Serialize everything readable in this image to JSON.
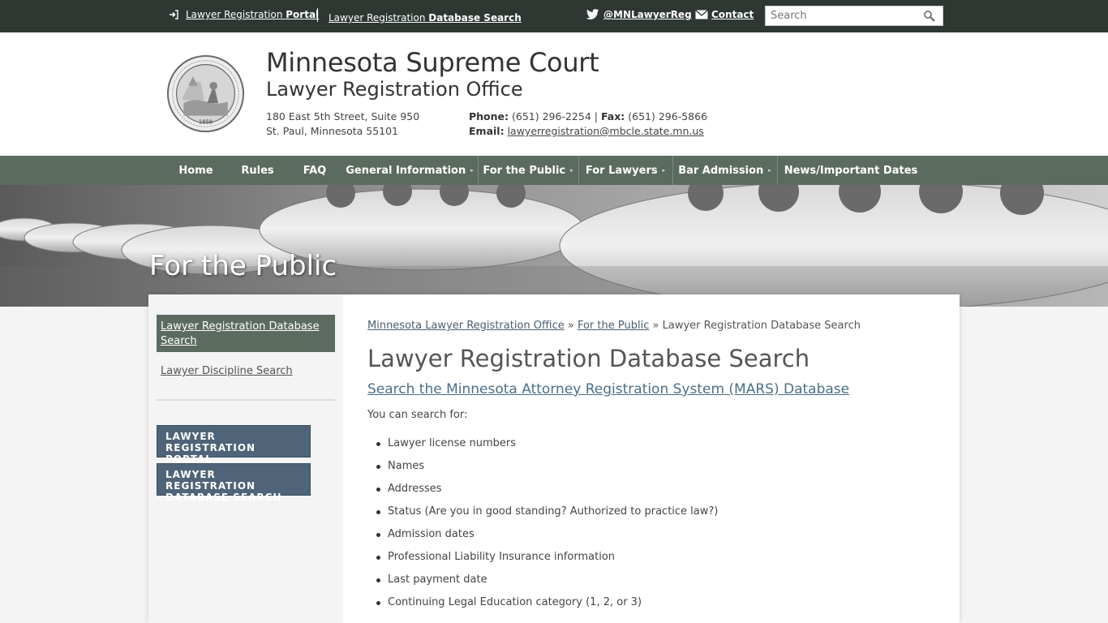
{
  "topbar": {
    "portal_prefix": "Lawyer Registration ",
    "portal_bold": "Portal",
    "db_prefix": "Lawyer Registration ",
    "db_bold": "Database Search",
    "twitter": "@MNLawyerReg",
    "contact": "Contact",
    "search_placeholder": "Search"
  },
  "header": {
    "title": "Minnesota Supreme Court",
    "subtitle": "Lawyer Registration Office",
    "address_line1": "180 East 5th Street, Suite 950",
    "address_line2": "St. Paul, Minnesota 55101",
    "phone_label": "Phone:",
    "phone": "(651) 296-2254",
    "fax_label": "Fax:",
    "fax": "(651) 296-5866",
    "email_label": "Email:",
    "email": "lawyerregistration@mbcle.state.mn.us",
    "seal_year": "1858"
  },
  "nav": {
    "items": [
      {
        "label": "Home"
      },
      {
        "label": "Rules"
      },
      {
        "label": "FAQ"
      },
      {
        "label": "General Information"
      },
      {
        "label": "For the Public"
      },
      {
        "label": "For Lawyers"
      },
      {
        "label": "Bar Admission"
      },
      {
        "label": "News/Important Dates"
      }
    ]
  },
  "banner": {
    "title": "For the Public"
  },
  "sidebar": {
    "active_item": "Lawyer Registration Database Search",
    "item2": "Lawyer Discipline Search",
    "btn1": "Lawyer Registration Portal",
    "btn2": "Lawyer Registration Database Search"
  },
  "main": {
    "breadcrumb": {
      "home": "Minnesota Lawyer Registration Office",
      "sep": "»",
      "parent": "For the Public",
      "current": "Lawyer Registration Database Search"
    },
    "title": "Lawyer Registration Database Search",
    "sub_link": "Search the Minnesota Attorney Registration System (MARS) Database",
    "intro": "You can search for:",
    "list": [
      "Lawyer license numbers",
      "Names",
      "Addresses",
      "Status (Are you in good standing? Authorized to practice law?)",
      "Admission dates",
      "Professional Liability Insurance information",
      "Last payment date",
      "Continuing Legal Education category (1, 2, or 3)"
    ]
  }
}
